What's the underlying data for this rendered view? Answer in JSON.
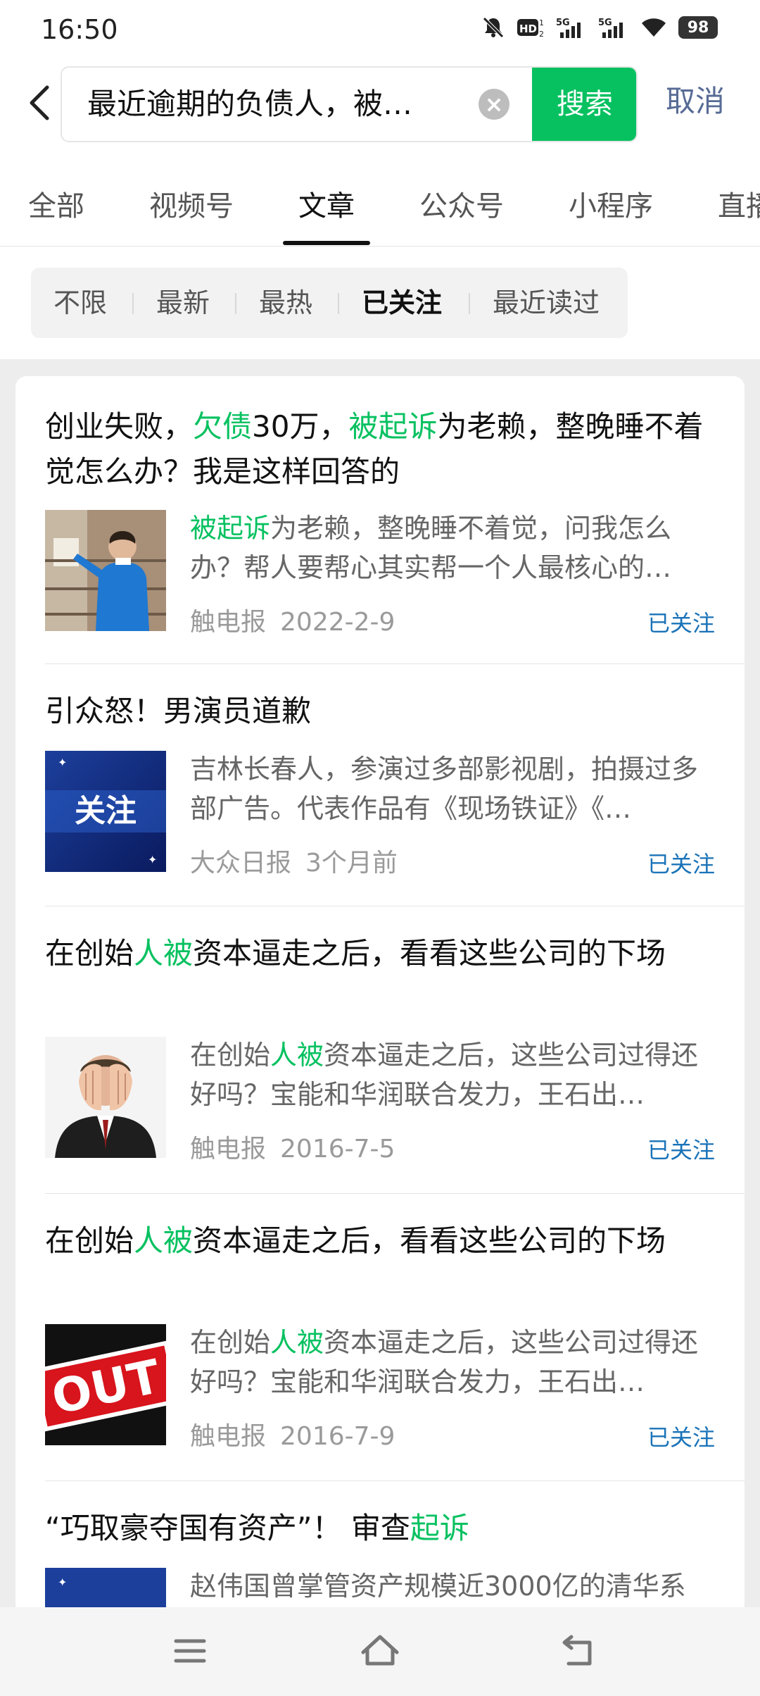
{
  "status_bar": {
    "time": "16:50",
    "battery": "98",
    "icons": [
      "mute-icon",
      "hd-icon",
      "5g-signal-icon",
      "5g-signal-icon",
      "wifi-icon",
      "battery-icon"
    ]
  },
  "search": {
    "query": "最近逾期的负债人，被…",
    "button_label": "搜索",
    "cancel_label": "取消"
  },
  "tabs": [
    {
      "label": "全部"
    },
    {
      "label": "视频号"
    },
    {
      "label": "文章",
      "active": true
    },
    {
      "label": "公众号"
    },
    {
      "label": "小程序"
    },
    {
      "label": "直播"
    }
  ],
  "filters": [
    {
      "label": "不限"
    },
    {
      "label": "最新"
    },
    {
      "label": "最热"
    },
    {
      "label": "已关注",
      "active": true
    },
    {
      "label": "最近读过"
    }
  ],
  "colors": {
    "accent": "#07c160",
    "link": "#576b95",
    "follow": "#1a73b8"
  },
  "results": [
    {
      "title_parts": [
        "创业失败，",
        "欠债",
        "30万，",
        "被起诉",
        "为老赖，整晚睡不着觉怎么办？我是这样回答的"
      ],
      "desc_parts": [
        "被起诉",
        "为老赖，整晚睡不着觉，问我怎么办？帮人要帮心其实帮一个人最核心的…"
      ],
      "source": "触电报",
      "date": "2022-2-9",
      "follow": "已关注",
      "thumb": "man-blue-shirt-photo"
    },
    {
      "title_parts": [
        "引众怒！男演员道歉"
      ],
      "desc_parts": [
        "吉林长春人，参演过多部影视剧，拍摄过多部广告。代表作品有《现场铁证》《…"
      ],
      "source": "大众日报",
      "date": "3个月前",
      "follow": "已关注",
      "thumb_text": "关注"
    },
    {
      "title_parts": [
        "在创始",
        "人被",
        "资本逼走之后，看看这些公司的下场"
      ],
      "desc_parts": [
        "在创始",
        "人被",
        "资本逼走之后，这些公司过得还好吗？宝能和华润联合发力，王石出…"
      ],
      "source": "触电报",
      "date": "2016-7-5",
      "follow": "已关注",
      "thumb": "man-head-in-hands-photo"
    },
    {
      "title_parts": [
        "在创始",
        "人被",
        "资本逼走之后，看看这些公司的下场"
      ],
      "desc_parts": [
        "在创始",
        "人被",
        "资本逼走之后，这些公司过得还好吗？宝能和华润联合发力，王石出…"
      ],
      "source": "触电报",
      "date": "2016-7-9",
      "follow": "已关注",
      "thumb_text": "OUT"
    },
    {
      "title_parts": [
        "“巧取豪夺国有资产”！ 审查",
        "起诉"
      ],
      "desc_parts": [
        "赵伟国曾掌管资产规模近3000亿的清华系"
      ],
      "thumb": "blue-news-thumb"
    }
  ],
  "nav_bar": {
    "icons": [
      "menu-icon",
      "home-icon",
      "back-icon"
    ]
  }
}
